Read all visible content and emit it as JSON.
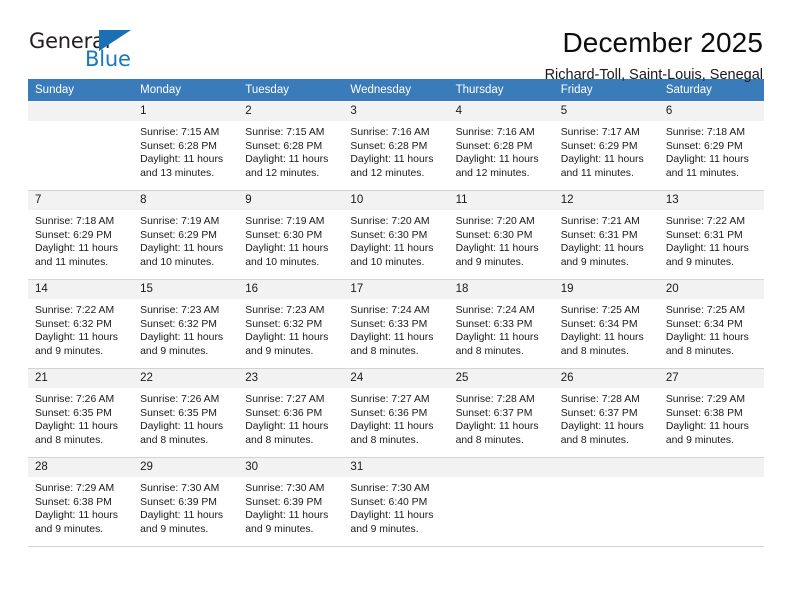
{
  "logo": {
    "word_one": "General",
    "word_two": "Blue",
    "triangle_color": "#1a6fb5",
    "text_color": "#231f20",
    "blue_color": "#1878be"
  },
  "header": {
    "title": "December 2025",
    "subtitle": "Richard-Toll, Saint-Louis, Senegal"
  },
  "theme": {
    "header_bg": "#3a7cba",
    "header_text": "#ffffff",
    "daynum_bg": "#f2f2f2",
    "grid_line": "#d4d4d4"
  },
  "weekdays": [
    "Sunday",
    "Monday",
    "Tuesday",
    "Wednesday",
    "Thursday",
    "Friday",
    "Saturday"
  ],
  "weeks": [
    [
      {
        "day": "",
        "sunrise": "",
        "sunset": "",
        "daylight_line1": "",
        "daylight_line2": ""
      },
      {
        "day": "1",
        "sunrise": "Sunrise: 7:15 AM",
        "sunset": "Sunset: 6:28 PM",
        "daylight_line1": "Daylight: 11 hours",
        "daylight_line2": "and 13 minutes."
      },
      {
        "day": "2",
        "sunrise": "Sunrise: 7:15 AM",
        "sunset": "Sunset: 6:28 PM",
        "daylight_line1": "Daylight: 11 hours",
        "daylight_line2": "and 12 minutes."
      },
      {
        "day": "3",
        "sunrise": "Sunrise: 7:16 AM",
        "sunset": "Sunset: 6:28 PM",
        "daylight_line1": "Daylight: 11 hours",
        "daylight_line2": "and 12 minutes."
      },
      {
        "day": "4",
        "sunrise": "Sunrise: 7:16 AM",
        "sunset": "Sunset: 6:28 PM",
        "daylight_line1": "Daylight: 11 hours",
        "daylight_line2": "and 12 minutes."
      },
      {
        "day": "5",
        "sunrise": "Sunrise: 7:17 AM",
        "sunset": "Sunset: 6:29 PM",
        "daylight_line1": "Daylight: 11 hours",
        "daylight_line2": "and 11 minutes."
      },
      {
        "day": "6",
        "sunrise": "Sunrise: 7:18 AM",
        "sunset": "Sunset: 6:29 PM",
        "daylight_line1": "Daylight: 11 hours",
        "daylight_line2": "and 11 minutes."
      }
    ],
    [
      {
        "day": "7",
        "sunrise": "Sunrise: 7:18 AM",
        "sunset": "Sunset: 6:29 PM",
        "daylight_line1": "Daylight: 11 hours",
        "daylight_line2": "and 11 minutes."
      },
      {
        "day": "8",
        "sunrise": "Sunrise: 7:19 AM",
        "sunset": "Sunset: 6:29 PM",
        "daylight_line1": "Daylight: 11 hours",
        "daylight_line2": "and 10 minutes."
      },
      {
        "day": "9",
        "sunrise": "Sunrise: 7:19 AM",
        "sunset": "Sunset: 6:30 PM",
        "daylight_line1": "Daylight: 11 hours",
        "daylight_line2": "and 10 minutes."
      },
      {
        "day": "10",
        "sunrise": "Sunrise: 7:20 AM",
        "sunset": "Sunset: 6:30 PM",
        "daylight_line1": "Daylight: 11 hours",
        "daylight_line2": "and 10 minutes."
      },
      {
        "day": "11",
        "sunrise": "Sunrise: 7:20 AM",
        "sunset": "Sunset: 6:30 PM",
        "daylight_line1": "Daylight: 11 hours",
        "daylight_line2": "and 9 minutes."
      },
      {
        "day": "12",
        "sunrise": "Sunrise: 7:21 AM",
        "sunset": "Sunset: 6:31 PM",
        "daylight_line1": "Daylight: 11 hours",
        "daylight_line2": "and 9 minutes."
      },
      {
        "day": "13",
        "sunrise": "Sunrise: 7:22 AM",
        "sunset": "Sunset: 6:31 PM",
        "daylight_line1": "Daylight: 11 hours",
        "daylight_line2": "and 9 minutes."
      }
    ],
    [
      {
        "day": "14",
        "sunrise": "Sunrise: 7:22 AM",
        "sunset": "Sunset: 6:32 PM",
        "daylight_line1": "Daylight: 11 hours",
        "daylight_line2": "and 9 minutes."
      },
      {
        "day": "15",
        "sunrise": "Sunrise: 7:23 AM",
        "sunset": "Sunset: 6:32 PM",
        "daylight_line1": "Daylight: 11 hours",
        "daylight_line2": "and 9 minutes."
      },
      {
        "day": "16",
        "sunrise": "Sunrise: 7:23 AM",
        "sunset": "Sunset: 6:32 PM",
        "daylight_line1": "Daylight: 11 hours",
        "daylight_line2": "and 9 minutes."
      },
      {
        "day": "17",
        "sunrise": "Sunrise: 7:24 AM",
        "sunset": "Sunset: 6:33 PM",
        "daylight_line1": "Daylight: 11 hours",
        "daylight_line2": "and 8 minutes."
      },
      {
        "day": "18",
        "sunrise": "Sunrise: 7:24 AM",
        "sunset": "Sunset: 6:33 PM",
        "daylight_line1": "Daylight: 11 hours",
        "daylight_line2": "and 8 minutes."
      },
      {
        "day": "19",
        "sunrise": "Sunrise: 7:25 AM",
        "sunset": "Sunset: 6:34 PM",
        "daylight_line1": "Daylight: 11 hours",
        "daylight_line2": "and 8 minutes."
      },
      {
        "day": "20",
        "sunrise": "Sunrise: 7:25 AM",
        "sunset": "Sunset: 6:34 PM",
        "daylight_line1": "Daylight: 11 hours",
        "daylight_line2": "and 8 minutes."
      }
    ],
    [
      {
        "day": "21",
        "sunrise": "Sunrise: 7:26 AM",
        "sunset": "Sunset: 6:35 PM",
        "daylight_line1": "Daylight: 11 hours",
        "daylight_line2": "and 8 minutes."
      },
      {
        "day": "22",
        "sunrise": "Sunrise: 7:26 AM",
        "sunset": "Sunset: 6:35 PM",
        "daylight_line1": "Daylight: 11 hours",
        "daylight_line2": "and 8 minutes."
      },
      {
        "day": "23",
        "sunrise": "Sunrise: 7:27 AM",
        "sunset": "Sunset: 6:36 PM",
        "daylight_line1": "Daylight: 11 hours",
        "daylight_line2": "and 8 minutes."
      },
      {
        "day": "24",
        "sunrise": "Sunrise: 7:27 AM",
        "sunset": "Sunset: 6:36 PM",
        "daylight_line1": "Daylight: 11 hours",
        "daylight_line2": "and 8 minutes."
      },
      {
        "day": "25",
        "sunrise": "Sunrise: 7:28 AM",
        "sunset": "Sunset: 6:37 PM",
        "daylight_line1": "Daylight: 11 hours",
        "daylight_line2": "and 8 minutes."
      },
      {
        "day": "26",
        "sunrise": "Sunrise: 7:28 AM",
        "sunset": "Sunset: 6:37 PM",
        "daylight_line1": "Daylight: 11 hours",
        "daylight_line2": "and 8 minutes."
      },
      {
        "day": "27",
        "sunrise": "Sunrise: 7:29 AM",
        "sunset": "Sunset: 6:38 PM",
        "daylight_line1": "Daylight: 11 hours",
        "daylight_line2": "and 9 minutes."
      }
    ],
    [
      {
        "day": "28",
        "sunrise": "Sunrise: 7:29 AM",
        "sunset": "Sunset: 6:38 PM",
        "daylight_line1": "Daylight: 11 hours",
        "daylight_line2": "and 9 minutes."
      },
      {
        "day": "29",
        "sunrise": "Sunrise: 7:30 AM",
        "sunset": "Sunset: 6:39 PM",
        "daylight_line1": "Daylight: 11 hours",
        "daylight_line2": "and 9 minutes."
      },
      {
        "day": "30",
        "sunrise": "Sunrise: 7:30 AM",
        "sunset": "Sunset: 6:39 PM",
        "daylight_line1": "Daylight: 11 hours",
        "daylight_line2": "and 9 minutes."
      },
      {
        "day": "31",
        "sunrise": "Sunrise: 7:30 AM",
        "sunset": "Sunset: 6:40 PM",
        "daylight_line1": "Daylight: 11 hours",
        "daylight_line2": "and 9 minutes."
      },
      {
        "day": "",
        "sunrise": "",
        "sunset": "",
        "daylight_line1": "",
        "daylight_line2": ""
      },
      {
        "day": "",
        "sunrise": "",
        "sunset": "",
        "daylight_line1": "",
        "daylight_line2": ""
      },
      {
        "day": "",
        "sunrise": "",
        "sunset": "",
        "daylight_line1": "",
        "daylight_line2": ""
      }
    ]
  ]
}
